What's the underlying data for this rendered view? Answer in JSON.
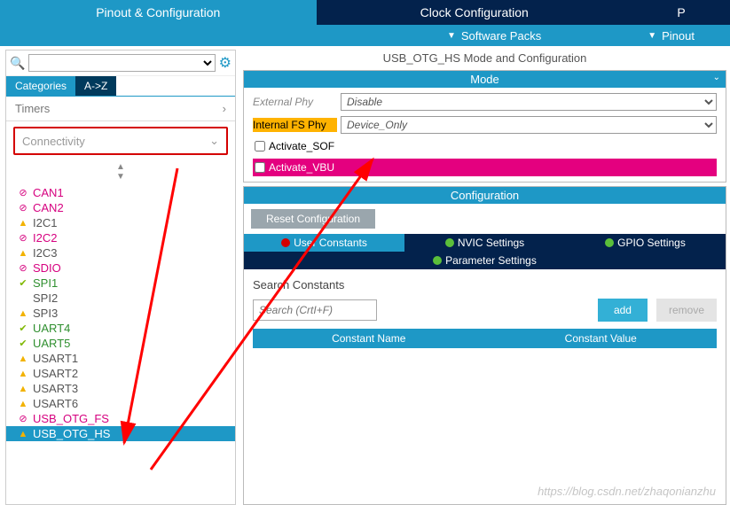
{
  "topbar": {
    "tabs": [
      "Pinout & Configuration",
      "Clock Configuration",
      "P"
    ]
  },
  "subbar": {
    "software": "Software Packs",
    "pinout": "Pinout"
  },
  "left": {
    "cat_tabs": [
      "Categories",
      "A->Z"
    ],
    "timers": "Timers",
    "connectivity": "Connectivity",
    "items": [
      {
        "icon": "no",
        "label": "CAN1",
        "cls": "pink"
      },
      {
        "icon": "no",
        "label": "CAN2",
        "cls": "pink"
      },
      {
        "icon": "warn",
        "label": "I2C1",
        "cls": "grey"
      },
      {
        "icon": "no",
        "label": "I2C2",
        "cls": "pink"
      },
      {
        "icon": "warn",
        "label": "I2C3",
        "cls": "grey"
      },
      {
        "icon": "no",
        "label": "SDIO",
        "cls": "pink"
      },
      {
        "icon": "ok",
        "label": "SPI1",
        "cls": "green"
      },
      {
        "icon": "",
        "label": "SPI2",
        "cls": "grey"
      },
      {
        "icon": "warn",
        "label": "SPI3",
        "cls": "grey"
      },
      {
        "icon": "ok",
        "label": "UART4",
        "cls": "green"
      },
      {
        "icon": "ok",
        "label": "UART5",
        "cls": "green"
      },
      {
        "icon": "warn",
        "label": "USART1",
        "cls": "grey"
      },
      {
        "icon": "warn",
        "label": "USART2",
        "cls": "grey"
      },
      {
        "icon": "warn",
        "label": "USART3",
        "cls": "grey"
      },
      {
        "icon": "warn",
        "label": "USART6",
        "cls": "grey"
      },
      {
        "icon": "no",
        "label": "USB_OTG_FS",
        "cls": "pink"
      },
      {
        "icon": "warn",
        "label": "USB_OTG_HS",
        "cls": "grey",
        "sel": true
      }
    ]
  },
  "right": {
    "title": "USB_OTG_HS Mode and Configuration",
    "mode_hdr": "Mode",
    "ext_phy_label": "External Phy",
    "ext_phy_value": "Disable",
    "int_phy_label": "Internal FS Phy",
    "int_phy_value": "Device_Only",
    "chk_sof": "Activate_SOF",
    "chk_vbus": "Activate_VBU",
    "cfg_hdr": "Configuration",
    "reset": "Reset Configuration",
    "tabs": {
      "user": "User Constants",
      "nvic": "NVIC Settings",
      "gpio": "GPIO Settings",
      "param": "Parameter Settings"
    },
    "search_title": "Search Constants",
    "search_ph": "Search (CrtI+F)",
    "add": "add",
    "remove": "remove",
    "col1": "Constant Name",
    "col2": "Constant Value"
  },
  "watermark": "https://blog.csdn.net/zhaqonianzhu"
}
